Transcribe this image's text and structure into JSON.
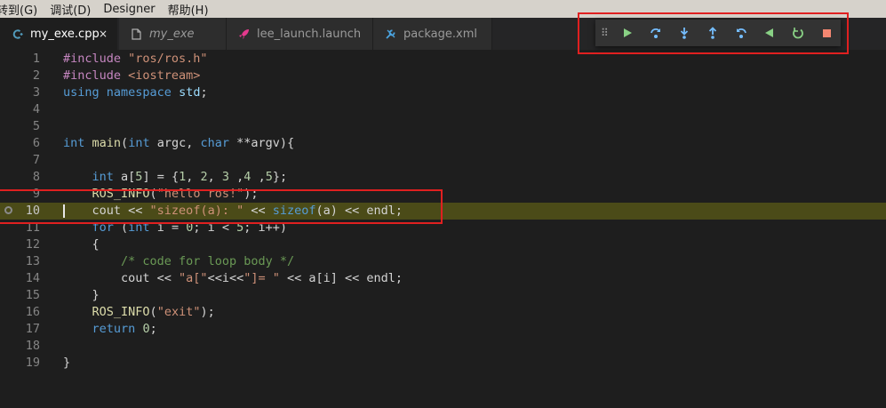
{
  "menu": {
    "items": [
      "转到(G)",
      "调试(D)",
      "Designer",
      "帮助(H)"
    ]
  },
  "tabs": [
    {
      "label": "my_exe.cpp",
      "icon": "cpp-file-icon",
      "active": true,
      "close": "×"
    },
    {
      "label": "my_exe",
      "icon": "file-icon",
      "preview": true
    },
    {
      "label": "lee_launch.launch",
      "icon": "rocket-icon"
    },
    {
      "label": "package.xml",
      "icon": "wrench-icon"
    }
  ],
  "debug_toolbar": {
    "buttons": [
      "continue-icon",
      "step-over-icon",
      "step-into-icon",
      "step-out-icon",
      "step-back-icon",
      "reverse-icon",
      "restart-icon",
      "stop-icon"
    ],
    "colors": {
      "green": "#89d185",
      "blue": "#75beff",
      "red": "#f48771",
      "annotation": "#e02020"
    }
  },
  "editor": {
    "current_line": 10,
    "lines": [
      {
        "n": "1",
        "tokens": [
          [
            "pre",
            "#include "
          ],
          [
            "str",
            "\"ros/ros.h\""
          ]
        ]
      },
      {
        "n": "2",
        "tokens": [
          [
            "pre",
            "#include "
          ],
          [
            "str",
            "<iostream>"
          ]
        ]
      },
      {
        "n": "3",
        "tokens": [
          [
            "kw",
            "using"
          ],
          [
            "",
            " "
          ],
          [
            "kw",
            "namespace"
          ],
          [
            "",
            " "
          ],
          [
            "var",
            "std"
          ],
          [
            "",
            ";"
          ]
        ]
      },
      {
        "n": "4",
        "tokens": []
      },
      {
        "n": "5",
        "tokens": []
      },
      {
        "n": "6",
        "tokens": [
          [
            "kw",
            "int"
          ],
          [
            "",
            " "
          ],
          [
            "fn",
            "main"
          ],
          [
            "",
            "("
          ],
          [
            "kw",
            "int"
          ],
          [
            "",
            " argc, "
          ],
          [
            "kw",
            "char"
          ],
          [
            "",
            " **argv){"
          ]
        ]
      },
      {
        "n": "7",
        "tokens": []
      },
      {
        "n": "8",
        "tokens": [
          [
            "",
            "    "
          ],
          [
            "kw",
            "int"
          ],
          [
            "",
            " a["
          ],
          [
            "num",
            "5"
          ],
          [
            "",
            "] = {"
          ],
          [
            "num",
            "1"
          ],
          [
            "",
            ", "
          ],
          [
            "num",
            "2"
          ],
          [
            "",
            ", "
          ],
          [
            "num",
            "3"
          ],
          [
            "",
            " ,"
          ],
          [
            "num",
            "4"
          ],
          [
            "",
            " ,"
          ],
          [
            "num",
            "5"
          ],
          [
            "",
            "};"
          ]
        ]
      },
      {
        "n": "9",
        "tokens": [
          [
            "",
            "    "
          ],
          [
            "fn",
            "ROS_INFO"
          ],
          [
            "",
            "("
          ],
          [
            "str",
            "\"hello ros!\""
          ],
          [
            "",
            ");"
          ]
        ]
      },
      {
        "n": "10",
        "tokens": [
          [
            "",
            "    cout << "
          ],
          [
            "str",
            "\"sizeof(a): \""
          ],
          [
            "",
            " << "
          ],
          [
            "kw",
            "sizeof"
          ],
          [
            "",
            "(a) << endl;"
          ]
        ]
      },
      {
        "n": "11",
        "tokens": [
          [
            "",
            "    "
          ],
          [
            "kw",
            "for"
          ],
          [
            "",
            " ("
          ],
          [
            "kw",
            "int"
          ],
          [
            "",
            " i = "
          ],
          [
            "num",
            "0"
          ],
          [
            "",
            "; i < "
          ],
          [
            "num",
            "5"
          ],
          [
            "",
            "; i++)"
          ]
        ]
      },
      {
        "n": "12",
        "tokens": [
          [
            "",
            "    {"
          ]
        ]
      },
      {
        "n": "13",
        "tokens": [
          [
            "",
            "        "
          ],
          [
            "cmt",
            "/* code for loop body */"
          ]
        ]
      },
      {
        "n": "14",
        "tokens": [
          [
            "",
            "        cout << "
          ],
          [
            "str",
            "\"a[\""
          ],
          [
            "",
            "<<i<<"
          ],
          [
            "str",
            "\"]= \""
          ],
          [
            "",
            " << a[i] << endl;"
          ]
        ]
      },
      {
        "n": "15",
        "tokens": [
          [
            "",
            "    }"
          ]
        ]
      },
      {
        "n": "16",
        "tokens": [
          [
            "",
            "    "
          ],
          [
            "fn",
            "ROS_INFO"
          ],
          [
            "",
            "("
          ],
          [
            "str",
            "\"exit\""
          ],
          [
            "",
            ");"
          ]
        ]
      },
      {
        "n": "17",
        "tokens": [
          [
            "",
            "    "
          ],
          [
            "kw",
            "return"
          ],
          [
            "",
            " "
          ],
          [
            "num",
            "0"
          ],
          [
            "",
            ";"
          ]
        ]
      },
      {
        "n": "18",
        "tokens": []
      },
      {
        "n": "19",
        "tokens": [
          [
            "",
            "}"
          ]
        ]
      }
    ]
  }
}
